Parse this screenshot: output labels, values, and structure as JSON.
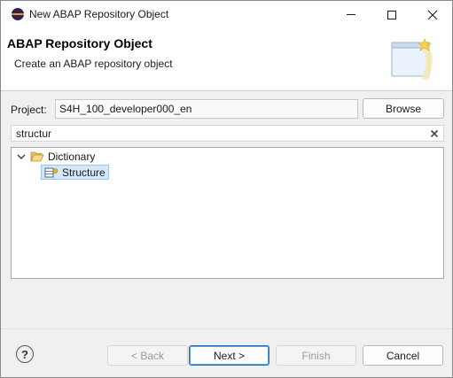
{
  "window": {
    "title": "New ABAP Repository Object"
  },
  "header": {
    "title": "ABAP Repository Object",
    "subtitle": "Create an ABAP repository object"
  },
  "form": {
    "project_label": "Project:",
    "project_value": "S4H_100_developer000_en",
    "browse_label": "Browse",
    "search_value": "structur"
  },
  "tree": {
    "nodes": [
      {
        "label": "Dictionary",
        "expanded": true,
        "icon": "folder-open-icon"
      },
      {
        "label": "Structure",
        "selected": true,
        "icon": "structure-icon"
      }
    ]
  },
  "footer": {
    "help": "?",
    "back_label": "< Back",
    "next_label": "Next >",
    "finish_label": "Finish",
    "cancel_label": "Cancel"
  },
  "colors": {
    "selection": "#d5e8fb",
    "default_button_border": "#1f6fbf",
    "eclipse_orange": "#f7941e"
  }
}
